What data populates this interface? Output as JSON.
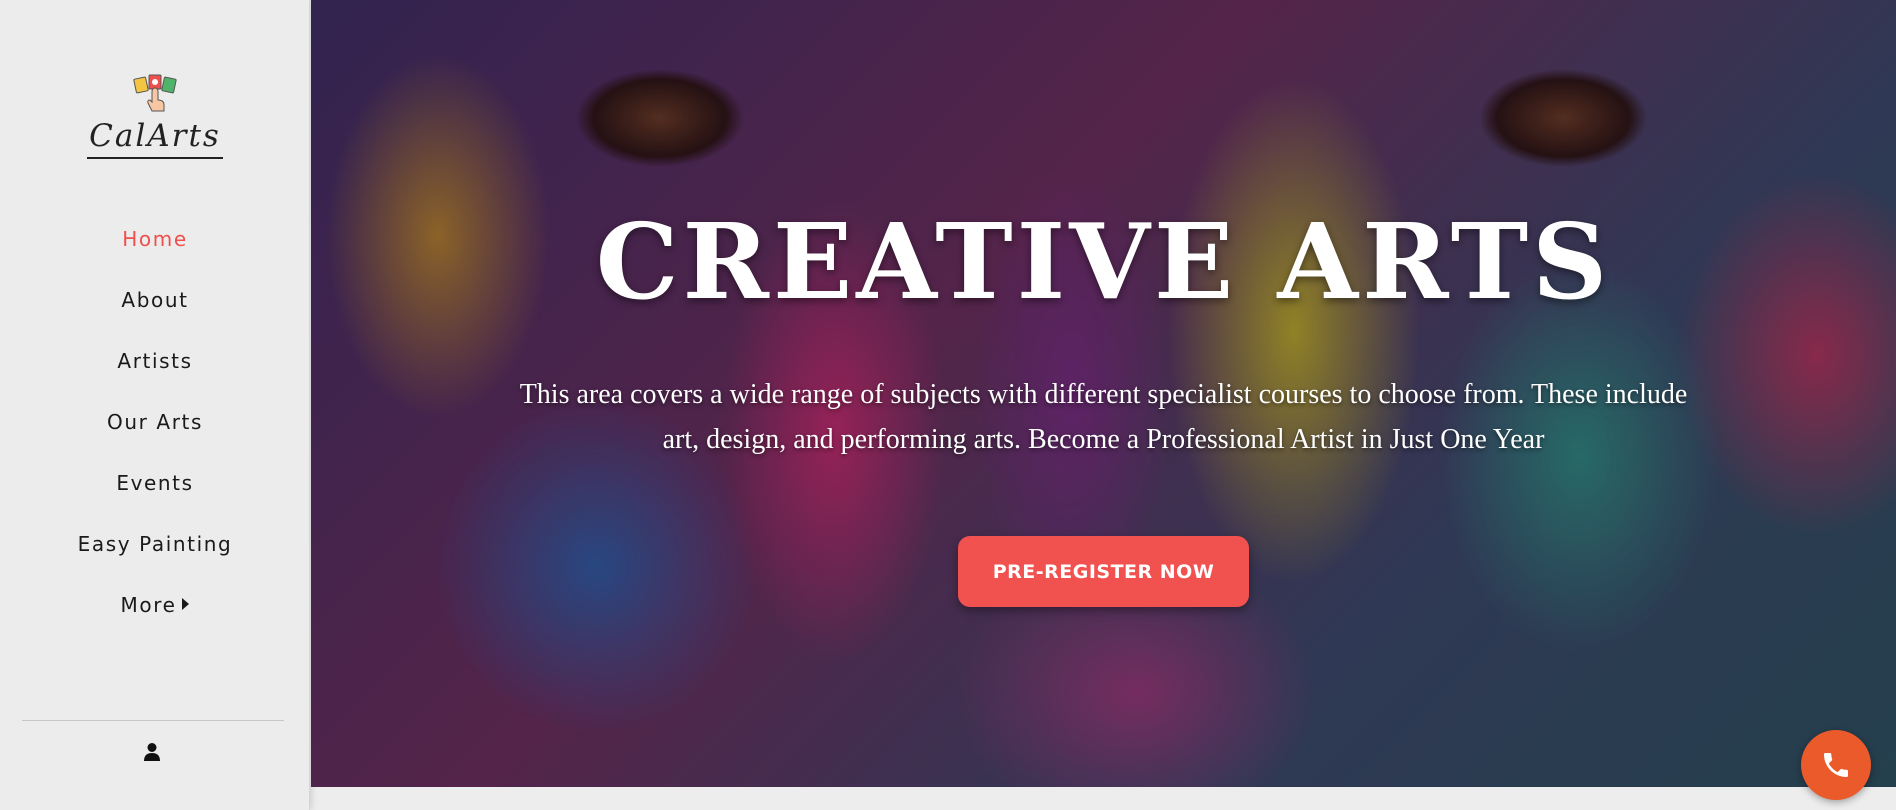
{
  "brand": {
    "name": "CalArts",
    "logo_icon": "art-cards-hand-icon"
  },
  "nav": {
    "items": [
      {
        "label": "Home",
        "active": true
      },
      {
        "label": "About",
        "active": false
      },
      {
        "label": "Artists",
        "active": false
      },
      {
        "label": "Our Arts",
        "active": false
      },
      {
        "label": "Events",
        "active": false
      },
      {
        "label": "Easy Painting",
        "active": false
      },
      {
        "label": "More",
        "active": false,
        "has_submenu": true
      }
    ],
    "user_icon": "user-icon"
  },
  "hero": {
    "title": "CREATIVE ARTS",
    "description": "This area covers a wide range of subjects with different specialist courses to choose from. These include art, design, and performing arts. Become a Professional Artist in Just One Year",
    "cta_label": "PRE-REGISTER NOW",
    "background": "face-painted-with-colors-photo"
  },
  "floating": {
    "phone_icon": "phone-icon"
  },
  "colors": {
    "accent": "#f1514f",
    "phone": "#ea5a2a",
    "sidebar_bg": "#ececec",
    "text": "#1a1a1a"
  }
}
